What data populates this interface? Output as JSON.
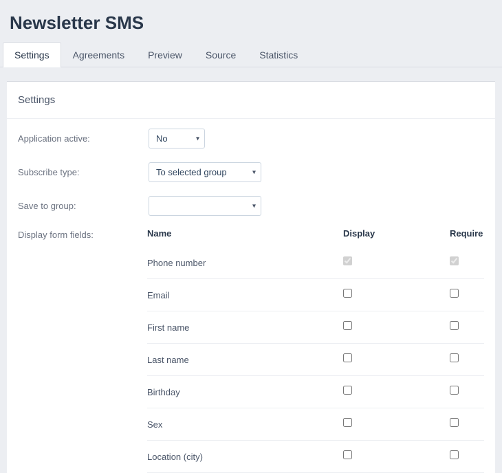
{
  "page_title": "Newsletter SMS",
  "tabs": [
    "Settings",
    "Agreements",
    "Preview",
    "Source",
    "Statistics"
  ],
  "active_tab": 0,
  "panel": {
    "title": "Settings"
  },
  "labels": {
    "application_active": "Application active:",
    "subscribe_type": "Subscribe type:",
    "save_to_group": "Save to group:",
    "display_form_fields": "Display form fields:"
  },
  "selects": {
    "application_active": {
      "value": "No"
    },
    "subscribe_type": {
      "value": "To selected group"
    },
    "save_to_group": {
      "value": ""
    }
  },
  "columns": {
    "name": "Name",
    "display": "Display",
    "require": "Require"
  },
  "fields": [
    {
      "name": "Phone number",
      "display": true,
      "require": true,
      "disabled": true
    },
    {
      "name": "Email",
      "display": false,
      "require": false,
      "disabled": false
    },
    {
      "name": "First name",
      "display": false,
      "require": false,
      "disabled": false
    },
    {
      "name": "Last name",
      "display": false,
      "require": false,
      "disabled": false
    },
    {
      "name": "Birthday",
      "display": false,
      "require": false,
      "disabled": false
    },
    {
      "name": "Sex",
      "display": false,
      "require": false,
      "disabled": false
    },
    {
      "name": "Location (city)",
      "display": false,
      "require": false,
      "disabled": false
    }
  ]
}
